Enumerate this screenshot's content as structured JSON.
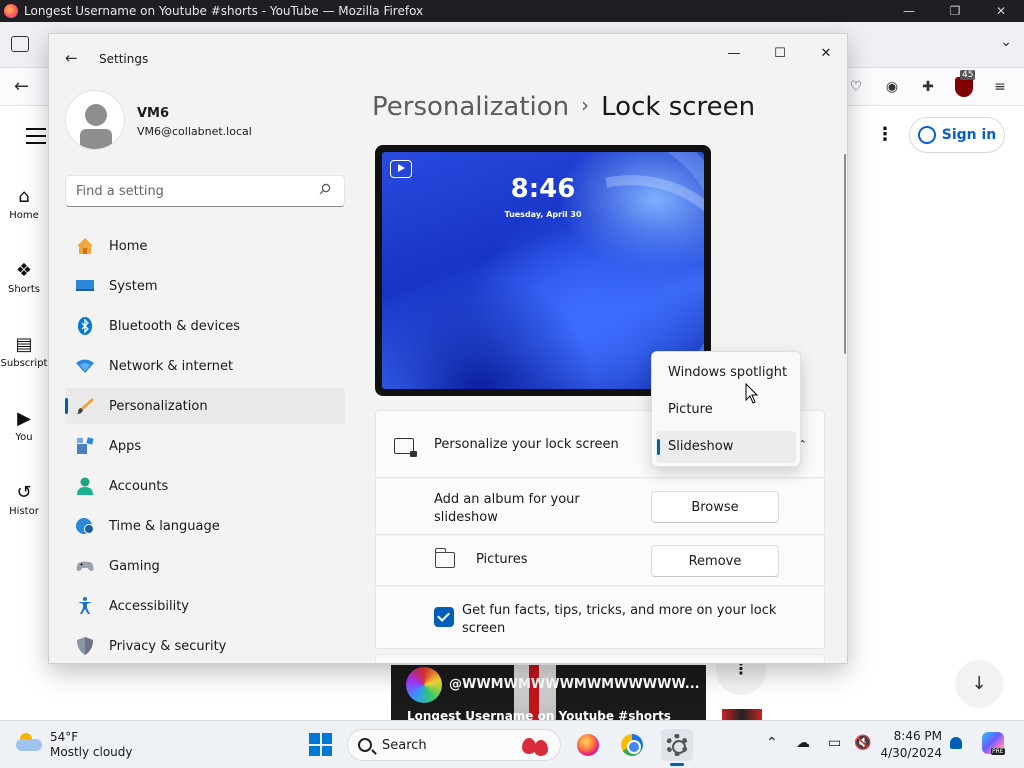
{
  "firefox": {
    "window_title": "Longest Username on Youtube #shorts - YouTube — Mozilla Firefox",
    "ublock_count": "45"
  },
  "youtube": {
    "sidebar": [
      {
        "label": "Home",
        "glyph": "⌂"
      },
      {
        "label": "Shorts",
        "glyph": "❖"
      },
      {
        "label": "Subscript",
        "glyph": "▤"
      },
      {
        "label": "You",
        "glyph": "▶"
      },
      {
        "label": "Histor",
        "glyph": "↺"
      }
    ],
    "sign_in_label": "Sign in",
    "channel_name": "@WWMWMWWWMWMWWWWW...",
    "video_title": "Longest Username on Youtube #shorts"
  },
  "settings": {
    "window_title": "Settings",
    "user": {
      "name": "VM6",
      "email": "VM6@collabnet.local"
    },
    "search_placeholder": "Find a setting",
    "nav": [
      {
        "label": "Home",
        "icon": "home-icon",
        "active": false
      },
      {
        "label": "System",
        "icon": "system-icon",
        "active": false
      },
      {
        "label": "Bluetooth & devices",
        "icon": "bluetooth-icon",
        "active": false
      },
      {
        "label": "Network & internet",
        "icon": "wifi-icon",
        "active": false
      },
      {
        "label": "Personalization",
        "icon": "brush-icon",
        "active": true
      },
      {
        "label": "Apps",
        "icon": "apps-icon",
        "active": false
      },
      {
        "label": "Accounts",
        "icon": "accounts-icon",
        "active": false
      },
      {
        "label": "Time & language",
        "icon": "globe-clock-icon",
        "active": false
      },
      {
        "label": "Gaming",
        "icon": "gamepad-icon",
        "active": false
      },
      {
        "label": "Accessibility",
        "icon": "accessibility-icon",
        "active": false
      },
      {
        "label": "Privacy & security",
        "icon": "shield-icon",
        "active": false
      }
    ],
    "breadcrumb": {
      "parent": "Personalization",
      "separator": "›",
      "current": "Lock screen"
    },
    "preview": {
      "time": "8:46",
      "date": "Tuesday, April 30"
    },
    "personalize_label": "Personalize your lock screen",
    "dropdown_options": [
      {
        "label": "Windows spotlight",
        "selected": false
      },
      {
        "label": "Picture",
        "selected": false
      },
      {
        "label": "Slideshow",
        "selected": true
      }
    ],
    "album_label": "Add an album for your slideshow",
    "browse_label": "Browse",
    "folder_label": "Pictures",
    "remove_label": "Remove",
    "fun_facts_label": "Get fun facts, tips, tricks, and more on your lock screen",
    "fun_facts_checked": true
  },
  "taskbar": {
    "weather_temp": "54°F",
    "weather_desc": "Mostly cloudy",
    "search_label": "Search",
    "clock_time": "8:46 PM",
    "clock_date": "4/30/2024",
    "copilot_badge": "PRE"
  }
}
